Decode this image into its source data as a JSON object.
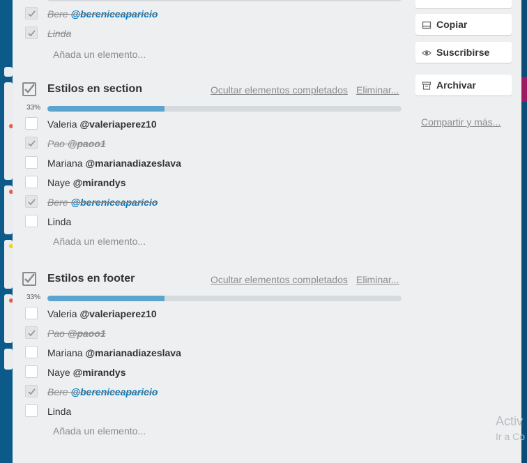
{
  "checklists": [
    {
      "title": "",
      "items": [
        {
          "text": "Bere",
          "mention": "@bereniceaparicio",
          "done": true,
          "link": true
        },
        {
          "text": "Linda",
          "mention": "",
          "done": true,
          "link": false
        }
      ],
      "add_label": "Añada un elemento..."
    },
    {
      "title": "Estilos en section",
      "hide_completed": "Ocultar elementos completados",
      "delete": "Eliminar...",
      "percent": "33%",
      "progress": 0.33,
      "items": [
        {
          "text": "Valeria",
          "mention": "@valeriaperez10",
          "done": false,
          "link": false
        },
        {
          "text": "Pao",
          "mention": "@paoo1",
          "done": true,
          "link": false
        },
        {
          "text": "Mariana",
          "mention": "@marianadiazeslava",
          "done": false,
          "link": false
        },
        {
          "text": "Naye",
          "mention": "@mirandys",
          "done": false,
          "link": false
        },
        {
          "text": "Bere",
          "mention": "@bereniceaparicio",
          "done": true,
          "link": true
        },
        {
          "text": "Linda",
          "mention": "",
          "done": false,
          "link": false
        }
      ],
      "add_label": "Añada un elemento..."
    },
    {
      "title": "Estilos en footer",
      "hide_completed": "Ocultar elementos completados",
      "delete": "Eliminar...",
      "percent": "33%",
      "progress": 0.33,
      "items": [
        {
          "text": "Valeria",
          "mention": "@valeriaperez10",
          "done": false,
          "link": false
        },
        {
          "text": "Pao",
          "mention": "@paoo1",
          "done": true,
          "link": false
        },
        {
          "text": "Mariana",
          "mention": "@marianadiazeslava",
          "done": false,
          "link": false
        },
        {
          "text": "Naye",
          "mention": "@mirandys",
          "done": false,
          "link": false
        },
        {
          "text": "Bere",
          "mention": "@bereniceaparicio",
          "done": true,
          "link": true
        },
        {
          "text": "Linda",
          "mention": "",
          "done": false,
          "link": false
        }
      ],
      "add_label": "Añada un elemento..."
    }
  ],
  "sidebar": {
    "copy": "Copiar",
    "subscribe": "Suscribirse",
    "archive": "Archivar",
    "share": "Compartir y más..."
  },
  "overlay": {
    "activate_title": "Activ",
    "activate_sub": "Ir a Co"
  },
  "colors": {
    "progress_fill": "#5ba4cf",
    "mention_link": "#0079bf"
  }
}
